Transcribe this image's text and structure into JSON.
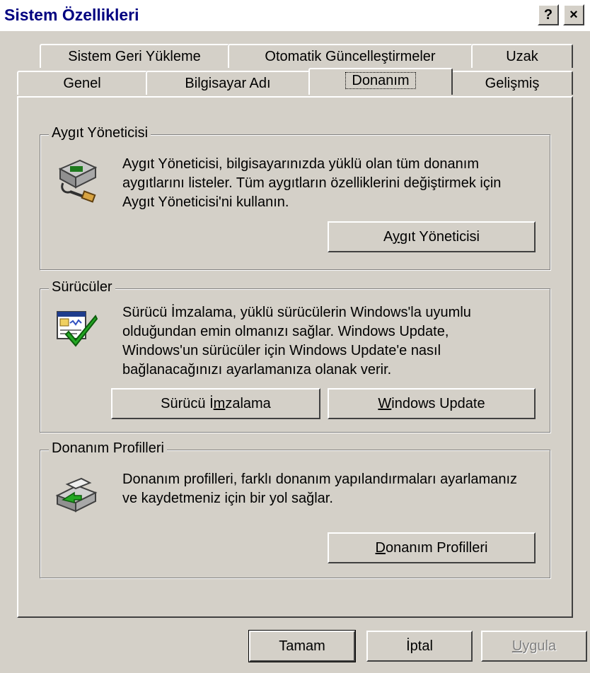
{
  "window": {
    "title": "Sistem Özellikleri",
    "help_glyph": "?",
    "close_glyph": "×"
  },
  "tabs": {
    "row1": [
      "Sistem Geri Yükleme",
      "Otomatik Güncelleştirmeler",
      "Uzak"
    ],
    "row2": [
      "Genel",
      "Bilgisayar Adı",
      "Donanım",
      "Gelişmiş"
    ],
    "active": "Donanım"
  },
  "device_manager": {
    "title": "Aygıt Yöneticisi",
    "lines": [
      "Aygıt Yöneticisi, bilgisayarınızda yüklü olan tüm donanım",
      "aygıtlarını listeler. Tüm aygıtların özelliklerini değiştirmek için",
      "Aygıt Yöneticisi'ni kullanın."
    ],
    "button_pre": "A",
    "button_u": "y",
    "button_post": "gıt Yöneticisi",
    "icon": "device-manager-icon"
  },
  "drivers": {
    "title": "Sürücüler",
    "lines": [
      "Sürücü İmzalama, yüklü sürücülerin Windows'la uyumlu",
      "olduğundan emin olmanızı sağlar. Windows Update,",
      "Windows'un sürücüler için Windows Update'e nasıl",
      "bağlanacağınızı ayarlamanıza olanak verir."
    ],
    "sign_pre": "Sürücü İ",
    "sign_u": "m",
    "sign_post": "zalama",
    "update_pre": "",
    "update_u": "W",
    "update_post": "indows Update",
    "icon": "driver-signing-icon"
  },
  "hardware_profiles": {
    "title": "Donanım Profilleri",
    "lines": [
      "Donanım profilleri, farklı donanım yapılandırmaları ayarlamanız",
      "ve kaydetmeniz için bir yol sağlar."
    ],
    "button_pre": "",
    "button_u": "D",
    "button_post": "onanım Profilleri",
    "icon": "hardware-profile-icon"
  },
  "footer": {
    "ok": "Tamam",
    "cancel": "İptal",
    "apply_u": "U",
    "apply_post": "ygula"
  }
}
